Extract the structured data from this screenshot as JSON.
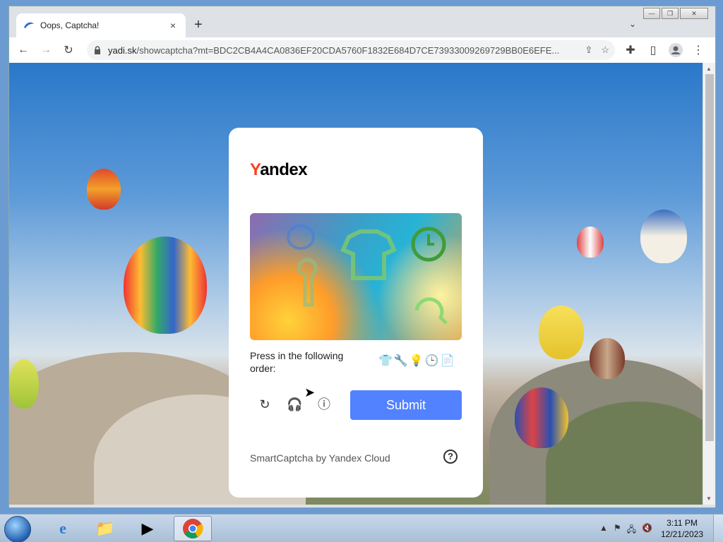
{
  "browser": {
    "tab_title": "Oops, Captcha!",
    "tab_close": "×",
    "new_tab": "+",
    "tab_menu": "⌄",
    "url_host": "yadi.sk",
    "url_path": "/showcaptcha?mt=BDC2CB4A4CA0836EF20CDA5760F1832E684D7CE73933009269729BB0E6EFE...",
    "window_controls": {
      "minimize": "—",
      "restore": "❐",
      "close": "✕"
    }
  },
  "captcha": {
    "logo_y": "Y",
    "logo_rest": "andex",
    "instruction": "Press in the following order:",
    "order_icons": [
      {
        "name": "tshirt-icon",
        "glyph": "👕"
      },
      {
        "name": "wrench-icon",
        "glyph": "🔧"
      },
      {
        "name": "lightbulb-icon",
        "glyph": "💡"
      },
      {
        "name": "clock-icon",
        "glyph": "🕒"
      },
      {
        "name": "document-icon",
        "glyph": "📄"
      }
    ],
    "submit_label": "Submit",
    "footer": "SmartCaptcha by Yandex Cloud",
    "help": "?",
    "accent_color": "#5282ff",
    "logo_accent": "#fc3f1d"
  },
  "taskbar": {
    "time": "3:11 PM",
    "date": "12/21/2023"
  }
}
